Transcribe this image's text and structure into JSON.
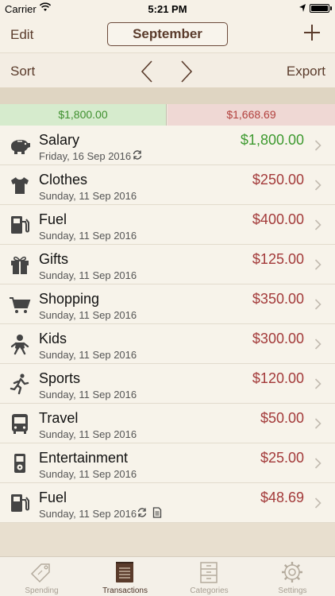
{
  "status_bar": {
    "carrier": "Carrier",
    "time": "5:21 PM"
  },
  "nav": {
    "edit": "Edit",
    "month": "September"
  },
  "toolbar": {
    "sort": "Sort",
    "export": "Export"
  },
  "totals": {
    "income": "$1,800.00",
    "expense": "$1,668.69"
  },
  "colors": {
    "income": "#3e9a30",
    "expense": "#a33a3a",
    "accent": "#5a3b2b"
  },
  "transactions": [
    {
      "name": "Salary",
      "date": "Friday, 16 Sep 2016",
      "amount": "$1,800.00",
      "type": "income",
      "icon": "piggy-bank-icon",
      "flags": [
        "repeat-icon"
      ]
    },
    {
      "name": "Clothes",
      "date": "Sunday, 11 Sep 2016",
      "amount": "$250.00",
      "type": "expense",
      "icon": "tshirt-icon",
      "flags": []
    },
    {
      "name": "Fuel",
      "date": "Sunday, 11 Sep 2016",
      "amount": "$400.00",
      "type": "expense",
      "icon": "fuel-pump-icon",
      "flags": []
    },
    {
      "name": "Gifts",
      "date": "Sunday, 11 Sep 2016",
      "amount": "$125.00",
      "type": "expense",
      "icon": "gift-icon",
      "flags": []
    },
    {
      "name": "Shopping",
      "date": "Sunday, 11 Sep 2016",
      "amount": "$350.00",
      "type": "expense",
      "icon": "cart-icon",
      "flags": []
    },
    {
      "name": "Kids",
      "date": "Sunday, 11 Sep 2016",
      "amount": "$300.00",
      "type": "expense",
      "icon": "baby-icon",
      "flags": []
    },
    {
      "name": "Sports",
      "date": "Sunday, 11 Sep 2016",
      "amount": "$120.00",
      "type": "expense",
      "icon": "runner-icon",
      "flags": []
    },
    {
      "name": "Travel",
      "date": "Sunday, 11 Sep 2016",
      "amount": "$50.00",
      "type": "expense",
      "icon": "bus-icon",
      "flags": []
    },
    {
      "name": "Entertainment",
      "date": "Sunday, 11 Sep 2016",
      "amount": "$25.00",
      "type": "expense",
      "icon": "music-player-icon",
      "flags": []
    },
    {
      "name": "Fuel",
      "date": "Sunday, 11 Sep 2016",
      "amount": "$48.69",
      "type": "expense",
      "icon": "fuel-pump-icon",
      "flags": [
        "repeat-icon",
        "note-icon"
      ]
    }
  ],
  "tabs": [
    {
      "label": "Spending",
      "icon": "price-tag-icon",
      "active": false
    },
    {
      "label": "Transactions",
      "icon": "notebook-icon",
      "active": true
    },
    {
      "label": "Categories",
      "icon": "drawers-icon",
      "active": false
    },
    {
      "label": "Settings",
      "icon": "gear-icon",
      "active": false
    }
  ]
}
